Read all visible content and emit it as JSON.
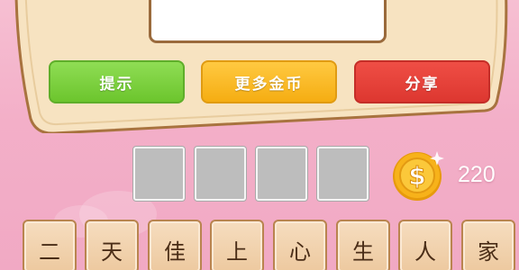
{
  "toolbar": {
    "hint_label": "提示",
    "more_coins_label": "更多金币",
    "share_label": "分享"
  },
  "answer_slots": [
    "",
    "",
    "",
    ""
  ],
  "coins": {
    "count": "220",
    "symbol": "$"
  },
  "letter_tiles": [
    "二",
    "天",
    "佳",
    "上",
    "心",
    "生",
    "人",
    "家"
  ],
  "colors": {
    "background": "#f3afc8",
    "board": "#f7e3c1",
    "hint_button": "#7ccf3c",
    "coins_button": "#f8b81e",
    "share_button": "#e3413a",
    "coin_gold": "#f7b21a"
  }
}
